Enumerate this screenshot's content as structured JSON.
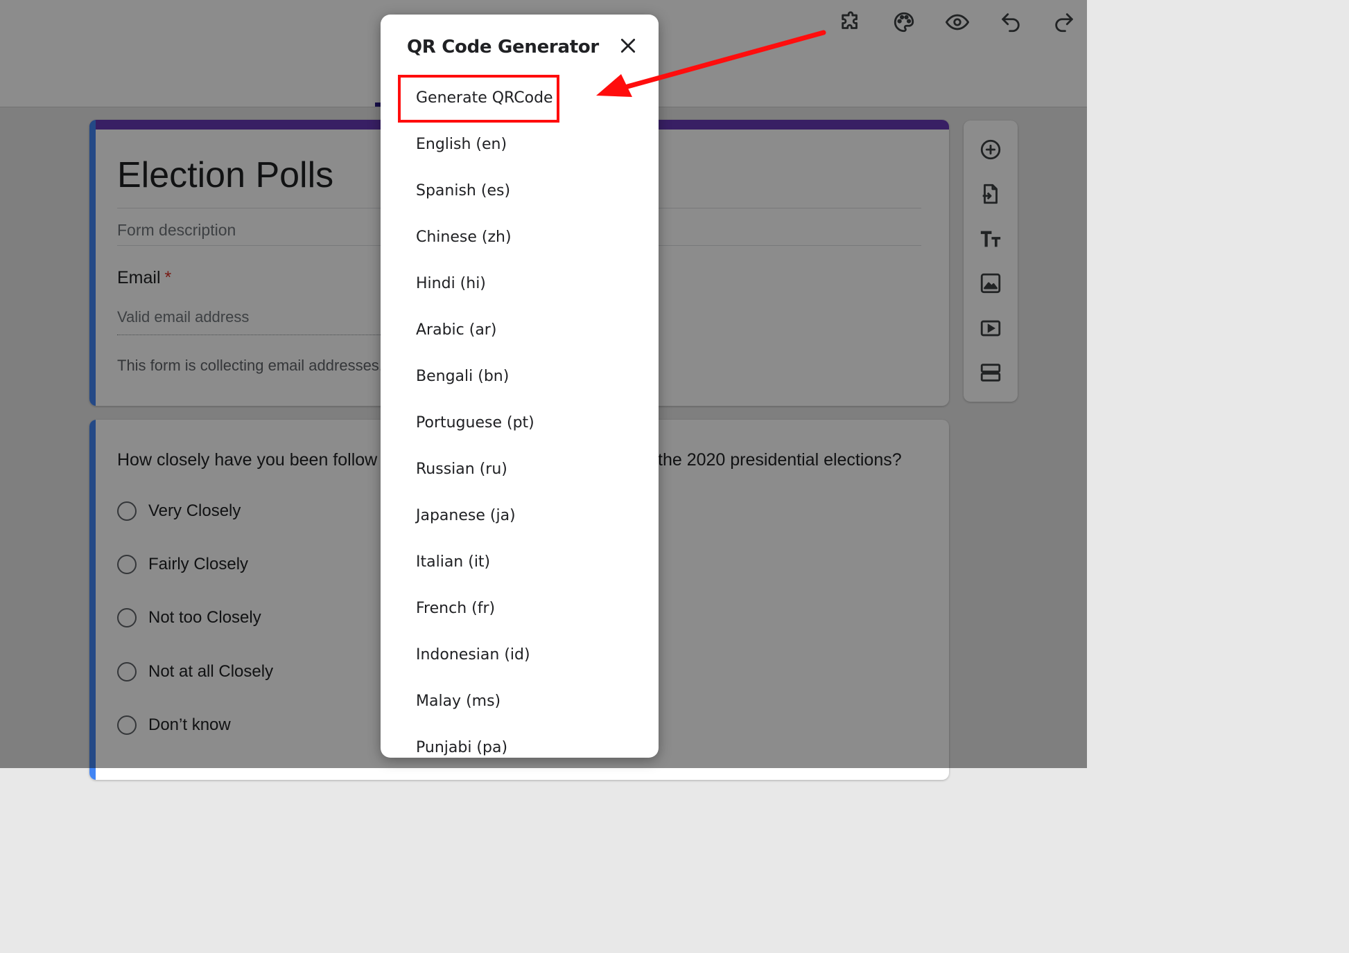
{
  "toolbar": {
    "icons": [
      "puzzle-icon",
      "palette-icon",
      "eye-icon",
      "undo-icon",
      "redo-icon"
    ]
  },
  "form": {
    "title": "Election Polls",
    "description_placeholder": "Form description",
    "email_label": "Email",
    "required_marker": "*",
    "email_placeholder": "Valid email address",
    "collect_note": "This form is collecting email addresses."
  },
  "question": {
    "text_visible_left": "How closely have you been follow",
    "text_visible_right": "the 2020 presidential elections?",
    "options": [
      "Very Closely",
      "Fairly Closely",
      "Not too Closely",
      "Not at all Closely",
      "Don’t know"
    ]
  },
  "side_toolbar": {
    "icons": [
      "add-question-icon",
      "import-questions-icon",
      "add-title-icon",
      "add-image-icon",
      "add-video-icon",
      "add-section-icon"
    ]
  },
  "dialog": {
    "title": "QR Code Generator",
    "close_icon": "close-icon",
    "generate_label": "Generate QRCode",
    "languages": [
      "English (en)",
      "Spanish (es)",
      "Chinese (zh)",
      "Hindi (hi)",
      "Arabic (ar)",
      "Bengali (bn)",
      "Portuguese (pt)",
      "Russian (ru)",
      "Japanese (ja)",
      "Italian (it)",
      "French (fr)",
      "Indonesian (id)",
      "Malay (ms)",
      "Punjabi (pa)"
    ]
  },
  "colors": {
    "accent_purple": "#673ab7",
    "accent_blue": "#4285f4",
    "annotation_red": "#ff0d0d",
    "required_red": "#d93025"
  }
}
